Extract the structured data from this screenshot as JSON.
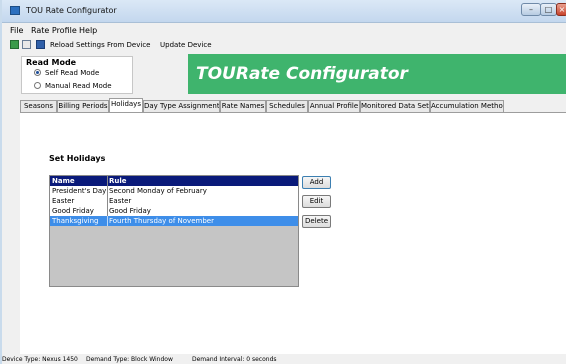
{
  "window": {
    "title": "TOU Rate Configurator"
  },
  "menu": [
    "File",
    "Rate Profile",
    "Help"
  ],
  "toolbar": {
    "reload_label": "Reload Settings From Device",
    "update_label": "Update Device"
  },
  "read_mode": {
    "title": "Read Mode",
    "options": [
      {
        "label": "Self Read Mode",
        "selected": true
      },
      {
        "label": "Manual Read Mode",
        "selected": false
      }
    ]
  },
  "banner": {
    "title": "TOURate Configurator",
    "color": "#3fb46d"
  },
  "tabs": [
    "Seasons",
    "Billing Periods",
    "Holidays",
    "Day Type Assignment",
    "Rate Names",
    "Schedules",
    "Annual Profile",
    "Monitored Data Sets",
    "Accumulation Method"
  ],
  "active_tab": "Holidays",
  "holidays": {
    "heading": "Set Holidays",
    "columns": [
      "Name",
      "Rule"
    ],
    "rows": [
      {
        "name": "President's Day",
        "rule": "Second Monday of February"
      },
      {
        "name": "Easter",
        "rule": "Easter"
      },
      {
        "name": "Good Friday",
        "rule": "Good Friday"
      },
      {
        "name": "Thanksgiving",
        "rule": "Fourth Thursday of November"
      }
    ],
    "selected_row": "Thanksgiving",
    "buttons": {
      "add": "Add",
      "edit": "Edit",
      "delete": "Delete"
    }
  },
  "status": {
    "device_type": "Device Type:  Nexus 1450",
    "demand_type": "Demand Type:  Block Window",
    "demand_interval": "Demand Interval:  0 seconds"
  }
}
